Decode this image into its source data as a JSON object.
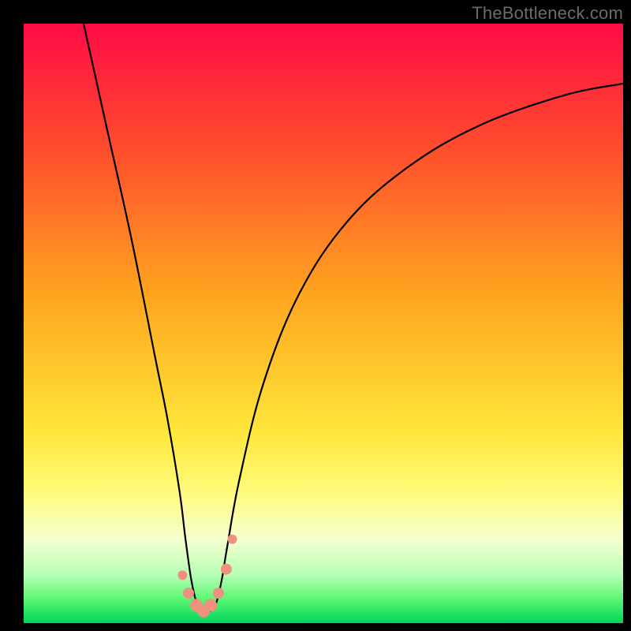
{
  "watermark": "TheBottleneck.com",
  "chart_data": {
    "type": "line",
    "title": "",
    "xlabel": "",
    "ylabel": "",
    "xlim": [
      0,
      100
    ],
    "ylim": [
      0,
      100
    ],
    "gradient_stops": [
      {
        "offset": 0,
        "color": "#ff0b46"
      },
      {
        "offset": 20,
        "color": "#ff4a2e"
      },
      {
        "offset": 45,
        "color": "#ffa41f"
      },
      {
        "offset": 68,
        "color": "#ffe63a"
      },
      {
        "offset": 78,
        "color": "#fffb7a"
      },
      {
        "offset": 86,
        "color": "#f5ffd0"
      },
      {
        "offset": 92,
        "color": "#b6ffb6"
      },
      {
        "offset": 96,
        "color": "#5cf771"
      },
      {
        "offset": 100,
        "color": "#00d45b"
      }
    ],
    "series": [
      {
        "name": "bottleneck-curve",
        "x": [
          10,
          14,
          18,
          22,
          24,
          26,
          27,
          28,
          29,
          30,
          31,
          32,
          33,
          34,
          36,
          40,
          46,
          54,
          64,
          76,
          90,
          100
        ],
        "y": [
          100,
          82,
          64,
          44,
          34,
          22,
          14,
          7,
          3,
          2,
          2,
          3,
          7,
          13,
          24,
          40,
          55,
          67,
          76,
          83,
          88,
          90
        ]
      }
    ],
    "markers": {
      "name": "bottom-cluster",
      "color": "#f0907e",
      "points": [
        {
          "x": 26.5,
          "y": 8,
          "r": 6
        },
        {
          "x": 27.5,
          "y": 5,
          "r": 7
        },
        {
          "x": 28.8,
          "y": 3,
          "r": 8
        },
        {
          "x": 30.0,
          "y": 2,
          "r": 8
        },
        {
          "x": 31.2,
          "y": 3,
          "r": 8
        },
        {
          "x": 32.5,
          "y": 5,
          "r": 7
        },
        {
          "x": 33.8,
          "y": 9,
          "r": 7
        },
        {
          "x": 34.8,
          "y": 14,
          "r": 6
        }
      ]
    }
  }
}
